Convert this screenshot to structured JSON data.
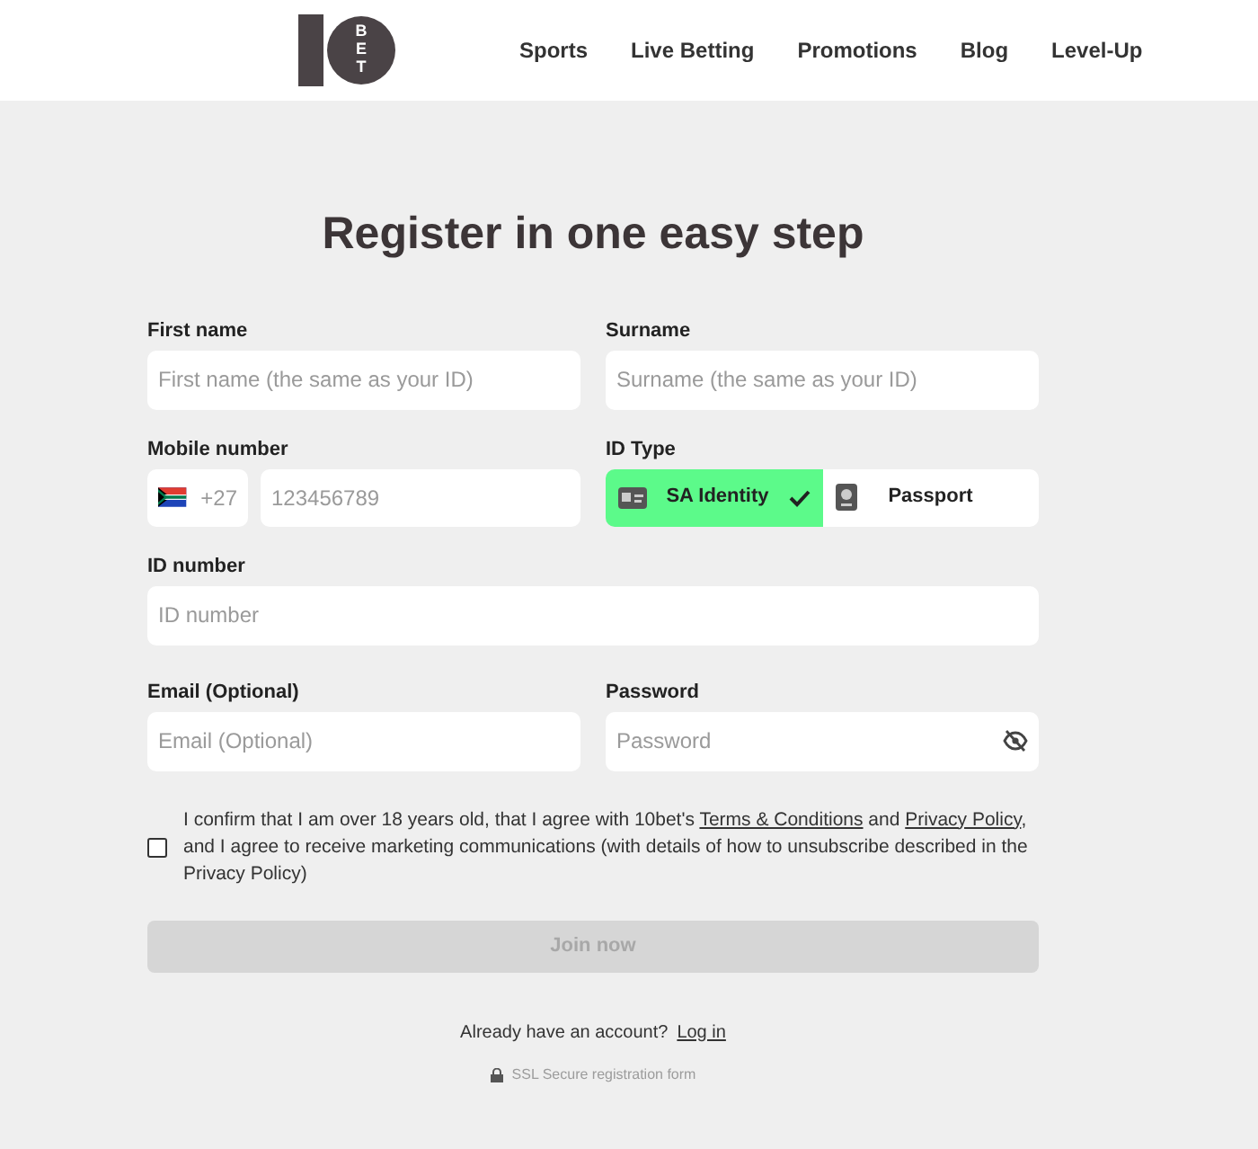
{
  "header": {
    "logo": {
      "word": "BET"
    },
    "nav": [
      {
        "label": "Sports"
      },
      {
        "label": "Live Betting"
      },
      {
        "label": "Promotions"
      },
      {
        "label": "Blog"
      },
      {
        "label": "Level-Up"
      }
    ]
  },
  "form": {
    "title": "Register in one easy step",
    "first_name": {
      "label": "First name",
      "placeholder": "First name (the same as your ID)"
    },
    "surname": {
      "label": "Surname",
      "placeholder": "Surname (the same as your ID)"
    },
    "mobile": {
      "label": "Mobile number",
      "country_code": "+27",
      "placeholder": "123456789"
    },
    "id_type": {
      "label": "ID Type",
      "options": [
        {
          "label": "SA Identity",
          "kind": "card",
          "selected": true
        },
        {
          "label": "Passport",
          "kind": "passport",
          "selected": false
        }
      ]
    },
    "id_number": {
      "label": "ID number",
      "placeholder": "ID number"
    },
    "email": {
      "label": "Email (Optional)",
      "placeholder": "Email (Optional)"
    },
    "password": {
      "label": "Password",
      "placeholder": "Password"
    },
    "consent": {
      "checked": false,
      "parts": [
        {
          "kind": "text",
          "text": "I confirm that I am over 18 years old, that I agree with 10bet's "
        },
        {
          "kind": "link",
          "text": "Terms & Conditions"
        },
        {
          "kind": "text",
          "text": " and "
        },
        {
          "kind": "link",
          "text": "Privacy Policy"
        },
        {
          "kind": "text",
          "text": ", and I agree to receive marketing communications (with details of how to unsubscribe described in the Privacy Policy)"
        }
      ]
    },
    "submit": {
      "label": "Join now",
      "disabled": true
    },
    "login_prompt": {
      "text": "Already have an account?",
      "link": "Log in"
    },
    "secure_note": "SSL Secure registration form"
  }
}
